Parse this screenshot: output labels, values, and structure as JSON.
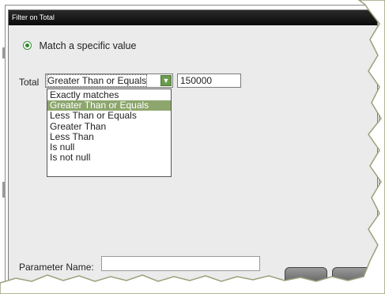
{
  "dialog": {
    "title": "Filter on Total",
    "radio_label": "Match a specific value",
    "field_label": "Total",
    "selected_operator": "Greater Than or Equals",
    "value": "150000",
    "options": [
      "Exactly matches",
      "Greater Than or Equals",
      "Less Than or Equals",
      "Greater Than",
      "Less Than",
      "Is null",
      "Is not null"
    ],
    "highlighted_option_index": 1,
    "parameter_label": "Parameter Name:",
    "parameter_value": ""
  },
  "colors": {
    "titlebar": "#111111",
    "highlight": "#8da66d",
    "dropdown_button": "#6c9a4e",
    "radio": "#2e8b2e",
    "dialog_bg": "#ebebeb"
  },
  "icons": {
    "dropdown": "chevron-down-icon",
    "radio": "radio-selected-icon"
  }
}
